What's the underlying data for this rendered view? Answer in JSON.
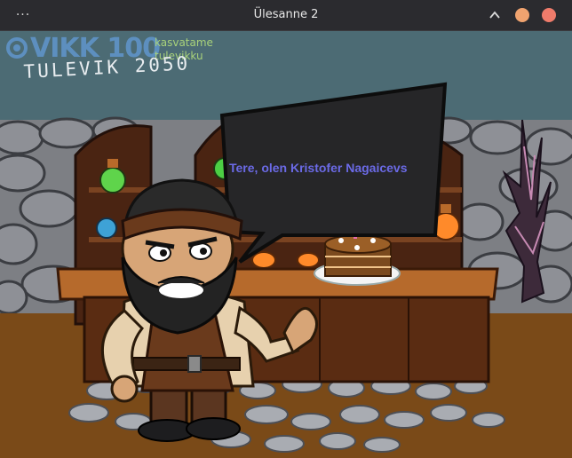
{
  "window": {
    "title": "Ülesanne 2",
    "menu_icon": "more-horizontal-icon",
    "buttons": [
      "minimize",
      "maximize",
      "close"
    ]
  },
  "logo": {
    "brand": "VIKK 100",
    "slogan_line1": "kasvatame",
    "slogan_line2": "tulevikku",
    "tagline": "TULEVIK 2050"
  },
  "dialog": {
    "text": "Tere, olen Kristofer Nagaicevs"
  },
  "colors": {
    "accent": "#6b6ae6",
    "window_close": "#ef7b6b",
    "window_maximize": "#f0a36f",
    "slogan": "#a9d27a"
  }
}
